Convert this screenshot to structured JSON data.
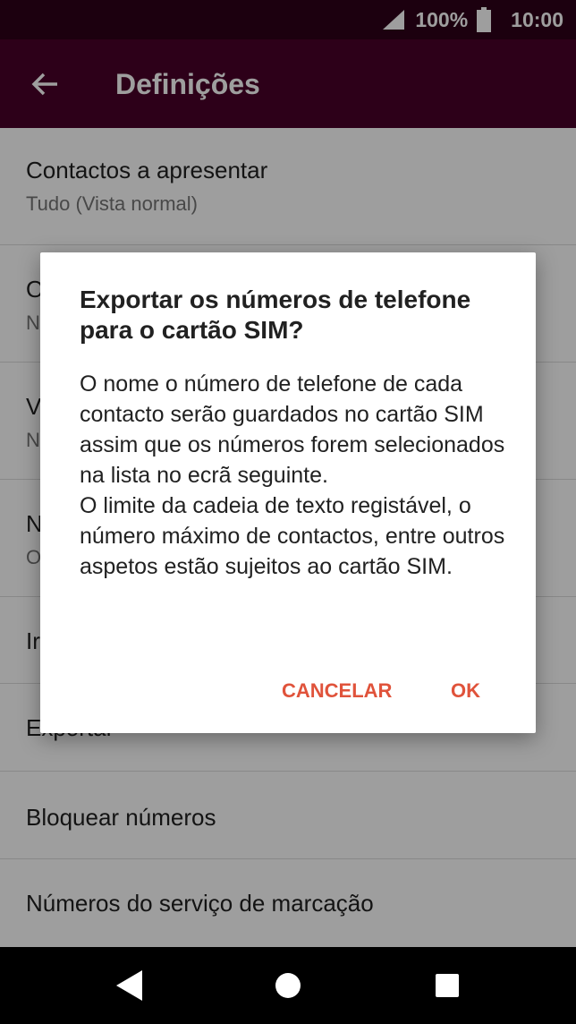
{
  "status_bar": {
    "battery": "100%",
    "time": "10:00",
    "icons": [
      "signal-icon",
      "battery-icon"
    ]
  },
  "app_bar": {
    "title": "Definições",
    "back_icon": "arrow-left-icon"
  },
  "settings": {
    "items": [
      {
        "primary": "Contactos a apresentar",
        "secondary": "Tudo (Vista normal)"
      },
      {
        "primary": "O",
        "secondary": "N"
      },
      {
        "primary": "V",
        "secondary": "N"
      },
      {
        "primary": "N",
        "secondary": "O"
      },
      {
        "primary": "Ir"
      },
      {
        "primary": "Exportar"
      },
      {
        "primary": "Bloquear números"
      },
      {
        "primary": "Números do serviço de marcação"
      }
    ]
  },
  "dialog": {
    "title": "Exportar os números de telefone para o cartão SIM?",
    "body_1": "O nome o número de telefone de cada contacto serão guardados no cartão SIM assim que os números forem selecionados na lista no ecrã seguinte.",
    "body_2": "O limite da cadeia de texto registável, o número máximo de contactos, entre outros aspetos estão sujeitos ao cartão SIM.",
    "cancel_label": "CANCELAR",
    "ok_label": "OK"
  },
  "nav_bar": {
    "icons": [
      "triangle-back-icon",
      "circle-home-icon",
      "square-recents-icon"
    ]
  },
  "colors": {
    "status_bar": "#2e0019",
    "app_bar": "#4a0129",
    "accent": "#e0533b"
  }
}
